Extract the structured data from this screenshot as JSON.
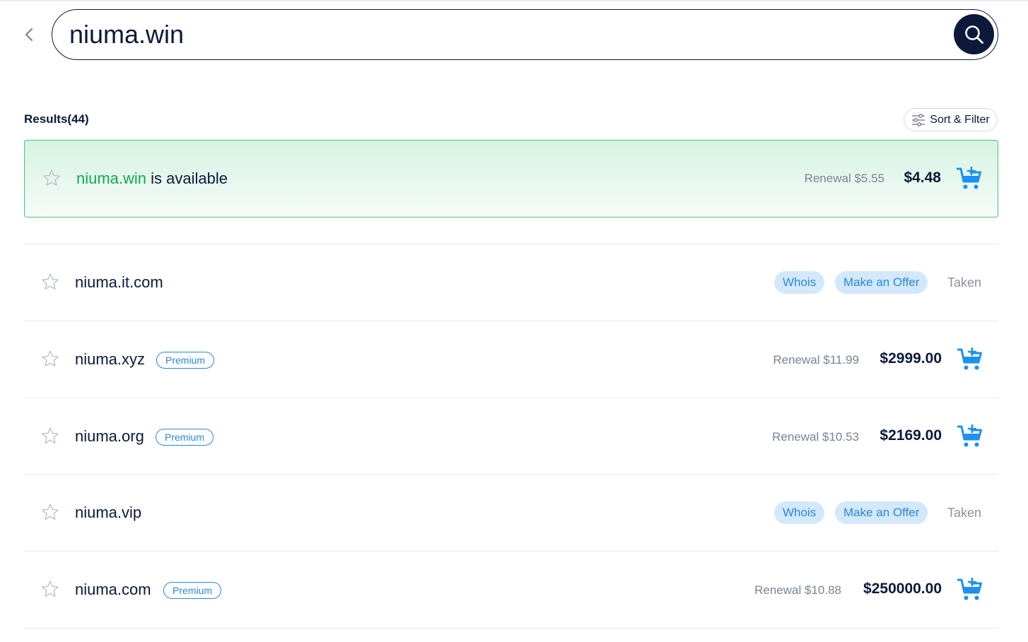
{
  "search": {
    "query": "niuma.win"
  },
  "results": {
    "label": "Results(44)"
  },
  "sort_filter": {
    "label": "Sort & Filter"
  },
  "featured": {
    "domain": "niuma.win",
    "status_text": " is available",
    "renewal": "Renewal $5.55",
    "price": "$4.48"
  },
  "rows": [
    {
      "domain": "niuma.it.com",
      "whois_label": "Whois",
      "offer_label": "Make an Offer",
      "status": "Taken"
    },
    {
      "domain": "niuma.xyz",
      "badge": "Premium",
      "renewal": "Renewal $11.99",
      "price": "$2999.00"
    },
    {
      "domain": "niuma.org",
      "badge": "Premium",
      "renewal": "Renewal $10.53",
      "price": "$2169.00"
    },
    {
      "domain": "niuma.vip",
      "whois_label": "Whois",
      "offer_label": "Make an Offer",
      "status": "Taken"
    },
    {
      "domain": "niuma.com",
      "badge": "Premium",
      "renewal": "Renewal $10.88",
      "price": "$250000.00"
    }
  ],
  "colors": {
    "navy": "#0b1a3a",
    "available_green": "#14a84e",
    "accent_blue": "#2c86d9",
    "pill_bg": "#d3e9fb",
    "cart_blue": "#1e90f0"
  },
  "icons": {
    "back": "chevron-left-icon",
    "search": "search-icon",
    "filter": "sliders-icon",
    "favorite": "star-icon",
    "cart": "cart-plus-icon"
  }
}
